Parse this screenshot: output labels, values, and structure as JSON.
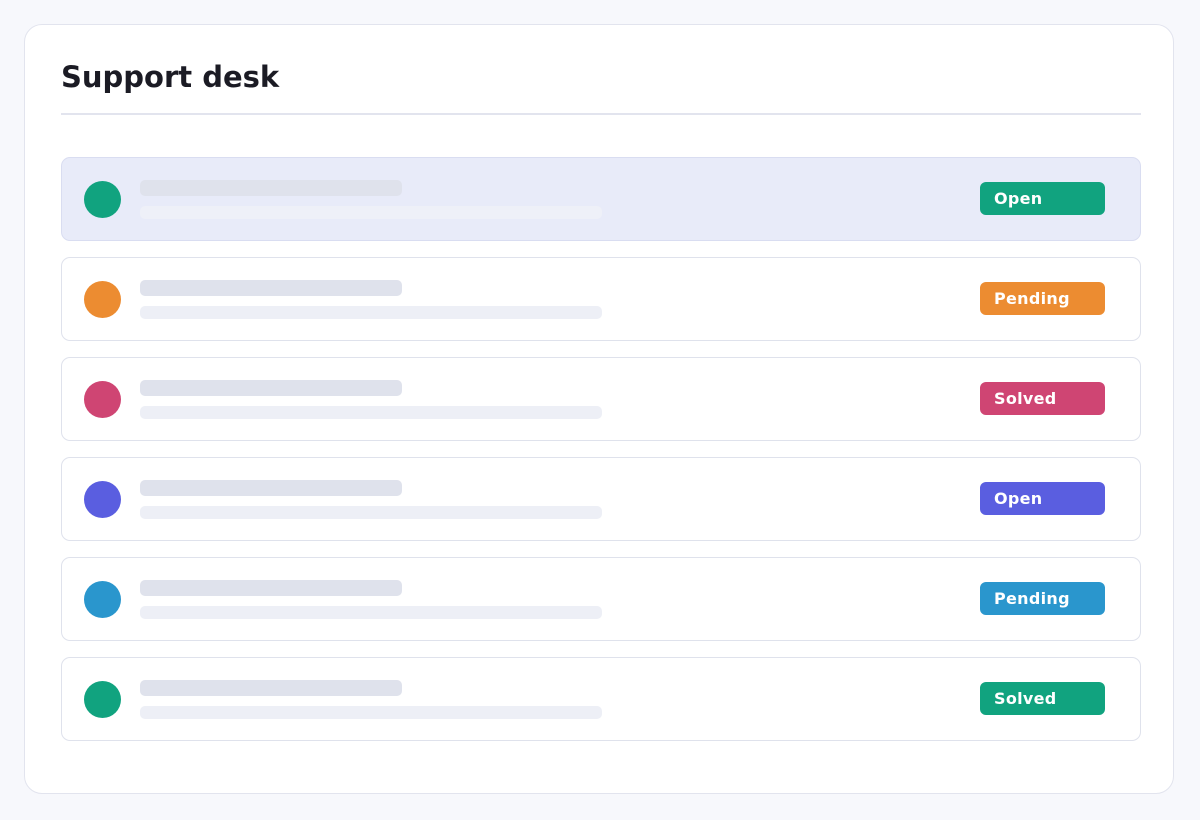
{
  "page": {
    "title": "Support desk"
  },
  "tickets": [
    {
      "status": "Open",
      "avatar_color": "#11a37f",
      "badge_color": "#11a37f",
      "selected": true
    },
    {
      "status": "Pending",
      "avatar_color": "#ec8c31",
      "badge_color": "#ec8c31",
      "selected": false
    },
    {
      "status": "Solved",
      "avatar_color": "#cf4573",
      "badge_color": "#cf4573",
      "selected": false
    },
    {
      "status": "Open",
      "avatar_color": "#5a5ee0",
      "badge_color": "#5a5ee0",
      "selected": false
    },
    {
      "status": "Pending",
      "avatar_color": "#2a96cd",
      "badge_color": "#2a96cd",
      "selected": false
    },
    {
      "status": "Solved",
      "avatar_color": "#11a37f",
      "badge_color": "#11a37f",
      "selected": false
    }
  ]
}
